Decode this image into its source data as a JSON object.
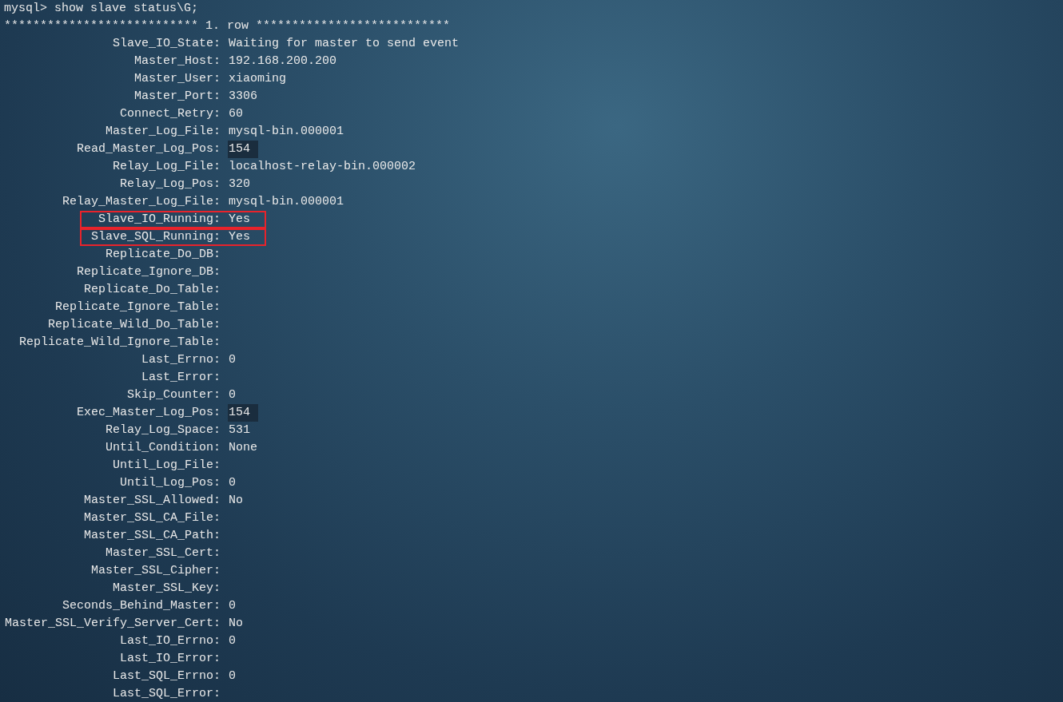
{
  "terminal": {
    "command_line": "mysql> show slave status\\G;",
    "row_header": "*************************** 1. row ***************************",
    "fields": [
      {
        "key": "Slave_IO_State:",
        "value": "Waiting for master to send event",
        "boxed": false,
        "shaded": false
      },
      {
        "key": "Master_Host:",
        "value": "192.168.200.200",
        "boxed": false,
        "shaded": false
      },
      {
        "key": "Master_User:",
        "value": "xiaoming",
        "boxed": false,
        "shaded": false
      },
      {
        "key": "Master_Port:",
        "value": "3306",
        "boxed": false,
        "shaded": false
      },
      {
        "key": "Connect_Retry:",
        "value": "60",
        "boxed": false,
        "shaded": false
      },
      {
        "key": "Master_Log_File:",
        "value": "mysql-bin.000001",
        "boxed": false,
        "shaded": false
      },
      {
        "key": "Read_Master_Log_Pos:",
        "value": "154",
        "boxed": false,
        "shaded": true
      },
      {
        "key": "Relay_Log_File:",
        "value": "localhost-relay-bin.000002",
        "boxed": false,
        "shaded": false
      },
      {
        "key": "Relay_Log_Pos:",
        "value": "320",
        "boxed": false,
        "shaded": false
      },
      {
        "key": "Relay_Master_Log_File:",
        "value": "mysql-bin.000001",
        "boxed": false,
        "shaded": false
      },
      {
        "key": "Slave_IO_Running:",
        "value": "Yes",
        "boxed": true,
        "shaded": false
      },
      {
        "key": "Slave_SQL_Running:",
        "value": "Yes",
        "boxed": true,
        "shaded": false
      },
      {
        "key": "Replicate_Do_DB:",
        "boxed": false
      },
      {
        "key": "Replicate_Ignore_DB:",
        "boxed": false
      },
      {
        "key": "Replicate_Do_Table:",
        "boxed": false
      },
      {
        "key": "Replicate_Ignore_Table:",
        "boxed": false
      },
      {
        "key": "Replicate_Wild_Do_Table:",
        "boxed": false
      },
      {
        "key": "Replicate_Wild_Ignore_Table:",
        "boxed": false
      },
      {
        "key": "Last_Errno:",
        "value": "0",
        "boxed": false,
        "shaded": false
      },
      {
        "key": "Last_Error:",
        "boxed": false
      },
      {
        "key": "Skip_Counter:",
        "value": "0",
        "boxed": false,
        "shaded": false
      },
      {
        "key": "Exec_Master_Log_Pos:",
        "value": "154",
        "boxed": false,
        "shaded": true
      },
      {
        "key": "Relay_Log_Space:",
        "value": "531",
        "boxed": false,
        "shaded": false
      },
      {
        "key": "Until_Condition:",
        "value": "None",
        "boxed": false,
        "shaded": false
      },
      {
        "key": "Until_Log_File:",
        "boxed": false
      },
      {
        "key": "Until_Log_Pos:",
        "value": "0",
        "boxed": false,
        "shaded": false
      },
      {
        "key": "Master_SSL_Allowed:",
        "value": "No",
        "boxed": false,
        "shaded": false
      },
      {
        "key": "Master_SSL_CA_File:",
        "boxed": false
      },
      {
        "key": "Master_SSL_CA_Path:",
        "boxed": false
      },
      {
        "key": "Master_SSL_Cert:",
        "boxed": false
      },
      {
        "key": "Master_SSL_Cipher:",
        "boxed": false
      },
      {
        "key": "Master_SSL_Key:",
        "boxed": false
      },
      {
        "key": "Seconds_Behind_Master:",
        "value": "0",
        "boxed": false,
        "shaded": false
      },
      {
        "key": "Master_SSL_Verify_Server_Cert:",
        "value": "No",
        "boxed": false,
        "shaded": false
      },
      {
        "key": "Last_IO_Errno:",
        "value": "0",
        "boxed": false,
        "shaded": false
      },
      {
        "key": "Last_IO_Error:",
        "boxed": false
      },
      {
        "key": "Last_SQL_Errno:",
        "value": "0",
        "boxed": false,
        "shaded": false
      },
      {
        "key": "Last_SQL_Error:",
        "boxed": false
      }
    ]
  }
}
